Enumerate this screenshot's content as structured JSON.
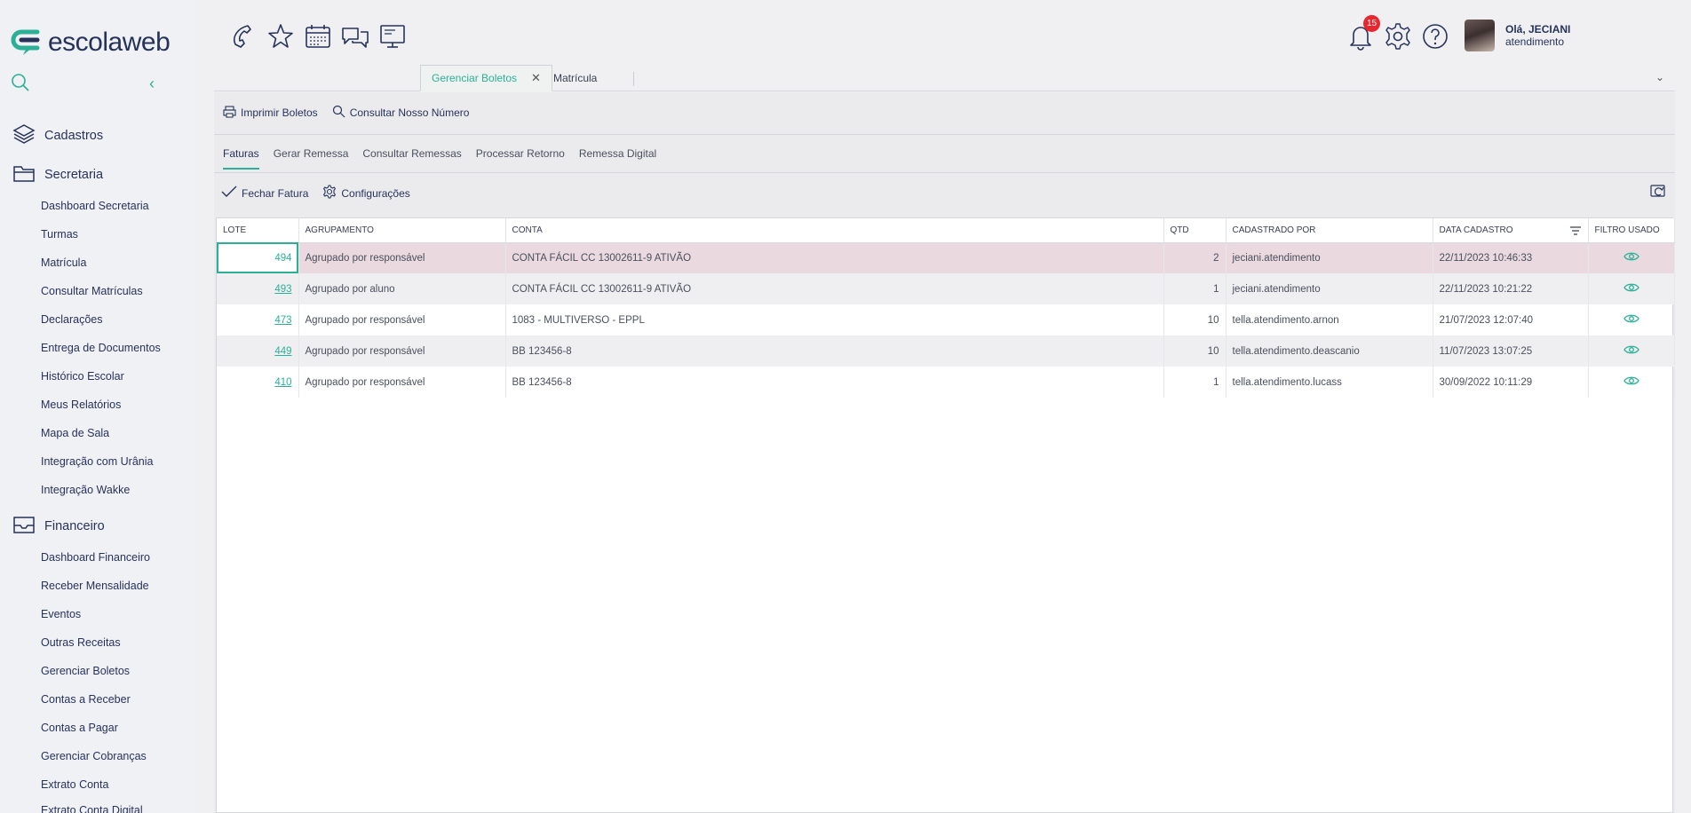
{
  "brand": {
    "name": "escolaweb",
    "accent": "#2bb097",
    "dark": "#26325a"
  },
  "sidebar": {
    "groups": [
      {
        "label": "Cadastros",
        "icon": "layers-icon",
        "items": []
      },
      {
        "label": "Secretaria",
        "icon": "folder-icon",
        "items": [
          "Dashboard Secretaria",
          "Turmas",
          "Matrícula",
          "Consultar Matrículas",
          "Declarações",
          "Entrega de Documentos",
          "Histórico Escolar",
          "Meus Relatórios",
          "Mapa de Sala",
          "Integração com Urânia",
          "Integração Wakke"
        ]
      },
      {
        "label": "Financeiro",
        "icon": "inbox-icon",
        "items": [
          "Dashboard Financeiro",
          "Receber Mensalidade",
          "Eventos",
          "Outras Receitas",
          "Gerenciar Boletos",
          "Contas a Receber",
          "Contas a Pagar",
          "Gerenciar Cobranças",
          "Extrato Conta",
          "Extrato Conta Digital"
        ]
      }
    ]
  },
  "topbar": {
    "icons": [
      "phone-icon",
      "star-icon",
      "calendar-icon",
      "chat-icon",
      "monitor-icon"
    ],
    "notifications_count": "15",
    "user": {
      "greeting": "Olá, JECIANI",
      "role": "atendimento"
    }
  },
  "tabs": [
    {
      "label": "Gerenciar Boletos",
      "active": true
    },
    {
      "label": "Matrícula",
      "active": false
    }
  ],
  "actions": {
    "print": "Imprimir Boletos",
    "consult": "Consultar Nosso Número"
  },
  "subtabs": [
    "Faturas",
    "Gerar Remessa",
    "Consultar Remessas",
    "Processar Retorno",
    "Remessa Digital"
  ],
  "actions2": {
    "close_invoice": "Fechar Fatura",
    "settings": "Configurações"
  },
  "table": {
    "columns": [
      "LOTE",
      "AGRUPAMENTO",
      "CONTA",
      "QTD",
      "CADASTRADO POR",
      "DATA CADASTRO",
      "FILTRO USADO"
    ],
    "rows": [
      {
        "lote": "494",
        "agrupamento": "Agrupado por responsável",
        "conta": "CONTA FÁCIL CC 13002611-9 ATIVÃO",
        "qtd": "2",
        "por": "jeciani.atendimento",
        "data": "22/11/2023 10:46:33"
      },
      {
        "lote": "493",
        "agrupamento": "Agrupado por aluno",
        "conta": "CONTA FÁCIL CC 13002611-9 ATIVÃO",
        "qtd": "1",
        "por": "jeciani.atendimento",
        "data": "22/11/2023 10:21:22"
      },
      {
        "lote": "473",
        "agrupamento": "Agrupado por responsável",
        "conta": "1083 - MULTIVERSO - EPPL",
        "qtd": "10",
        "por": "tella.atendimento.arnon",
        "data": "21/07/2023 12:07:40"
      },
      {
        "lote": "449",
        "agrupamento": "Agrupado por responsável",
        "conta": "BB 123456-8",
        "qtd": "10",
        "por": "tella.atendimento.deascanio",
        "data": "11/07/2023 13:07:25"
      },
      {
        "lote": "410",
        "agrupamento": "Agrupado por responsável",
        "conta": "BB 123456-8",
        "qtd": "1",
        "por": "tella.atendimento.lucass",
        "data": "30/09/2022 10:11:29"
      }
    ]
  }
}
